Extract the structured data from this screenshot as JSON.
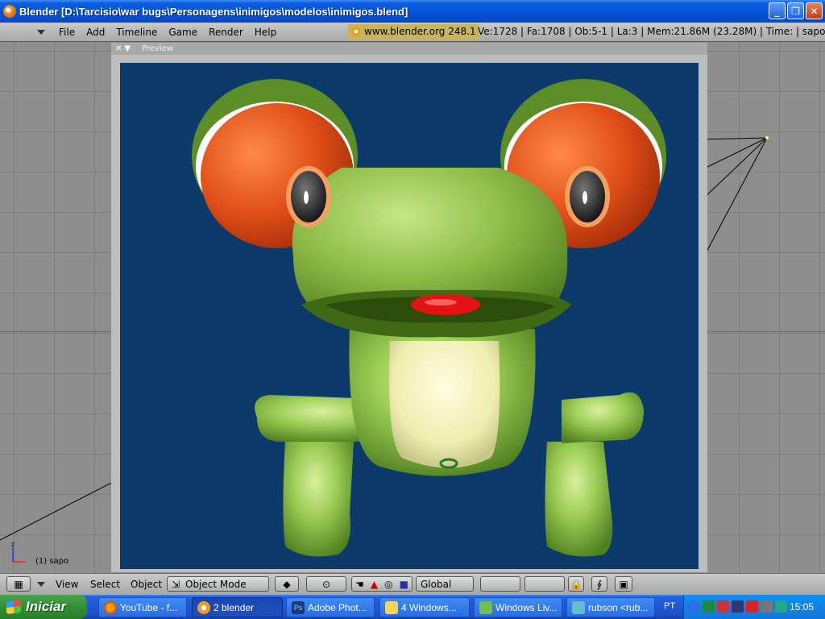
{
  "window": {
    "title": "Blender [D:\\Tarcisio\\war bugs\\Personagens\\inimigos\\modelos\\inimigos.blend]",
    "minimize": "_",
    "maximize": "❐",
    "close": "✕"
  },
  "info_header": {
    "menus": [
      "File",
      "Add",
      "Timeline",
      "Game",
      "Render",
      "Help"
    ],
    "url": "www.blender.org 248.1",
    "stats": "Ve:1728 | Fa:1708 | Ob:5-1 | La:3  | Mem:21.86M (23.28M)  | Time:  | sapo"
  },
  "preview": {
    "header_label": "Preview",
    "close": "✕",
    "menu": "▼"
  },
  "viewport": {
    "object_label": "(1) sapo",
    "axis_z": "z",
    "axis_x": "x"
  },
  "viewport_header": {
    "menus": [
      "View",
      "Select",
      "Object"
    ],
    "mode": "Object Mode",
    "orientation": "Global"
  },
  "taskbar": {
    "start_label": "Iniciar",
    "tasks": [
      {
        "label": "YouTube - f..."
      },
      {
        "label": "2 blender"
      },
      {
        "label": "Adobe Phot..."
      },
      {
        "label": "4 Windows..."
      },
      {
        "label": "Windows Liv..."
      },
      {
        "label": "rubson <rub..."
      }
    ],
    "language": "PT",
    "clock": "15:05"
  },
  "colors": {
    "title_blue": "#0451d6",
    "preview_bg": "#0b3a6b",
    "frog_green": "#8cc04a",
    "eye_orange": "#e5521c",
    "tongue_red": "#e01010"
  }
}
